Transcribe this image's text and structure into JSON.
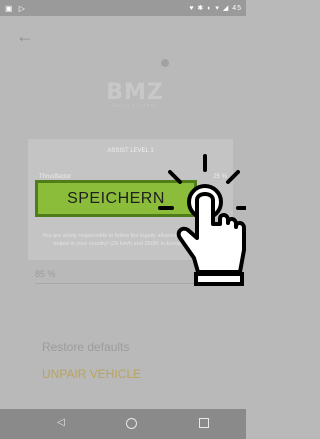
{
  "statusbar": {
    "left_icons": "▣ ▷",
    "right_icons": "♥ ✱ ◐ ▾ ◢ 45"
  },
  "app": {
    "back_icon": "back-arrow-icon"
  },
  "logo": {
    "text": "BMZ",
    "subtitle": "DRIVE SYSTEMS"
  },
  "background": {
    "value": "85 %",
    "restore_label": "Restore defaults",
    "unpair_label": "UNPAIR VEHICLE"
  },
  "dialog": {
    "title": "ASSIST LEVEL 1",
    "field_label": "Thrustfactor",
    "field_value": "25 %",
    "slider_level": 0.25,
    "disclaimer": "You are solely responsible to follow the legally allowed speed and motor output in your country! (25 km/h and 250W in European Union)"
  },
  "save_button": {
    "label": "SPEICHERN"
  },
  "colors": {
    "accent": "#8bbd3a",
    "accent_border": "#4f7d1a",
    "overlay": "#b9b9b9"
  }
}
